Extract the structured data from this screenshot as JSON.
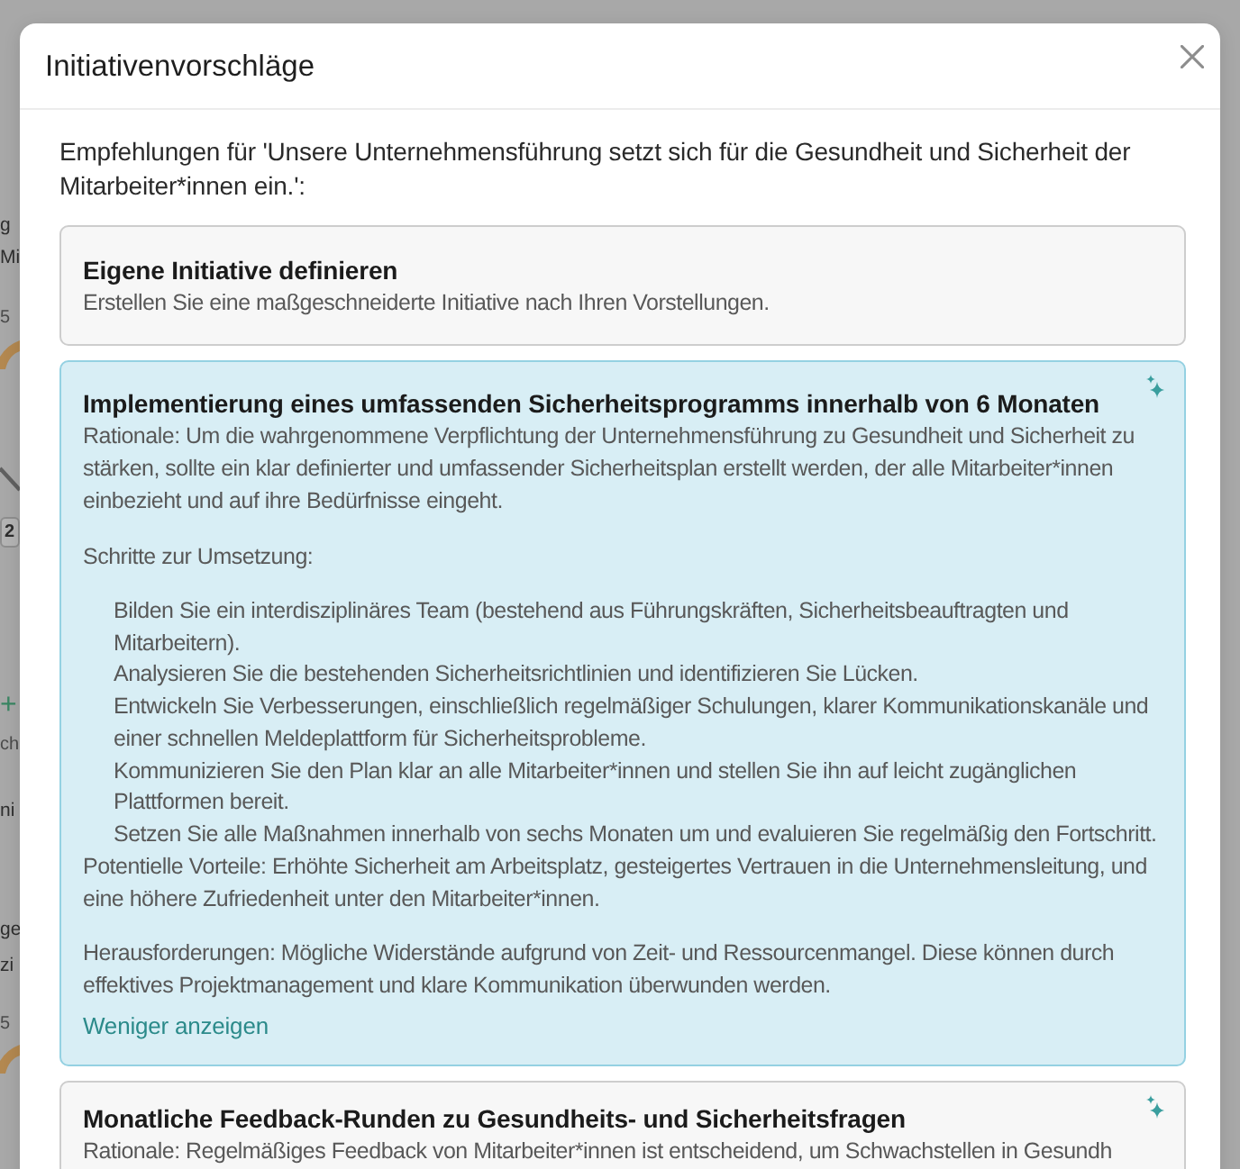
{
  "background": {
    "fragments": [
      {
        "kind": "text",
        "text": "g"
      },
      {
        "kind": "text",
        "text": "Mi"
      },
      {
        "kind": "tick",
        "text": "5"
      },
      {
        "kind": "badge",
        "text": "2"
      },
      {
        "kind": "delta",
        "text": "+"
      },
      {
        "kind": "tick",
        "text": "ch"
      },
      {
        "kind": "text",
        "text": "ni"
      },
      {
        "kind": "text",
        "text": "ge"
      },
      {
        "kind": "text",
        "text": "zi"
      },
      {
        "kind": "tick",
        "text": "5"
      }
    ]
  },
  "modal": {
    "title": "Initiativenvorschläge",
    "intro": "Empfehlungen für 'Unsere Unternehmensführung setzt sich für die Gesundheit und Sicherheit der Mitarbeiter*innen ein.':",
    "suggestions": [
      {
        "kind": "custom",
        "selected": false,
        "title": "Eigene Initiative definieren",
        "description": "Erstellen Sie eine maßgeschneiderte Initiative nach Ihren Vorstellungen."
      },
      {
        "kind": "generated",
        "selected": true,
        "expanded": true,
        "title": "Implementierung eines umfassenden Sicherheitsprogramms innerhalb von 6 Monaten",
        "rationale": "Rationale: Um die wahrgenommene Verpflichtung der Unternehmensführung zu Gesundheit und Sicherheit zu stärken, sollte ein klar definierter und umfassender Sicherheitsplan erstellt werden, der alle Mitarbeiter*innen einbezieht und auf ihre Bedürfnisse eingeht.",
        "steps_heading": "Schritte zur Umsetzung:",
        "steps": [
          "Bilden Sie ein interdisziplinäres Team (bestehend aus Führungskräften, Sicherheitsbeauftragten und Mitarbeitern).",
          "Analysieren Sie die bestehenden Sicherheitsrichtlinien und identifizieren Sie Lücken.",
          "Entwickeln Sie Verbesserungen, einschließlich regelmäßiger Schulungen, klarer Kommunikationskanäle und einer schnellen Meldeplattform für Sicherheitsprobleme.",
          "Kommunizieren Sie den Plan klar an alle Mitarbeiter*innen und stellen Sie ihn auf leicht zugänglichen Plattformen bereit.",
          "Setzen Sie alle Maßnahmen innerhalb von sechs Monaten um und evaluieren Sie regelmäßig den Fortschritt."
        ],
        "benefits": "Potentielle Vorteile: Erhöhte Sicherheit am Arbeitsplatz, gesteigertes Vertrauen in die Unternehmensleitung, und eine höhere Zufriedenheit unter den Mitarbeiter*innen.",
        "challenges": "Herausforderungen: Mögliche Widerstände aufgrund von Zeit- und Ressourcenmangel. Diese können durch effektives Projektmanagement und klare Kommunikation überwunden werden.",
        "toggle_label": "Weniger anzeigen"
      },
      {
        "kind": "generated",
        "selected": false,
        "expanded": false,
        "title": "Monatliche Feedback-Runden zu Gesundheits- und Sicherheitsfragen",
        "rationale": "Rationale: Regelmäßiges Feedback von Mitarbeiter*innen ist entscheidend, um Schwachstellen in Gesundh"
      }
    ]
  }
}
